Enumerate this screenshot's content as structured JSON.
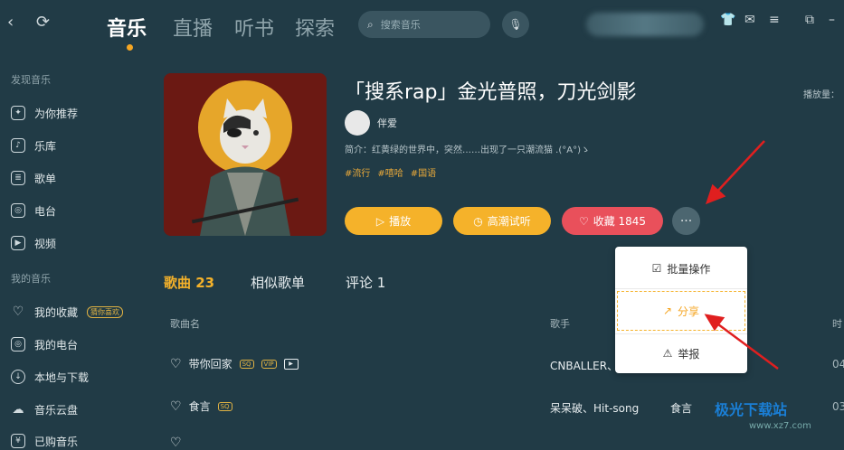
{
  "nav": {
    "tabs": [
      {
        "label": "音乐",
        "active": true
      },
      {
        "label": "直播"
      },
      {
        "label": "听书"
      },
      {
        "label": "探索"
      }
    ],
    "search_placeholder": "搜索音乐"
  },
  "sidebar": {
    "discover_heading": "发现音乐",
    "discover_items": [
      {
        "label": "为你推荐",
        "icon": "recommend-icon"
      },
      {
        "label": "乐库",
        "icon": "library-icon"
      },
      {
        "label": "歌单",
        "icon": "playlist-icon"
      },
      {
        "label": "电台",
        "icon": "radio-icon"
      },
      {
        "label": "视频",
        "icon": "video-icon"
      }
    ],
    "my_heading": "我的音乐",
    "my_items": [
      {
        "label": "我的收藏",
        "icon": "heart-icon",
        "badge": "猜你喜欢"
      },
      {
        "label": "我的电台",
        "icon": "radio-icon"
      },
      {
        "label": "本地与下载",
        "icon": "download-icon"
      },
      {
        "label": "音乐云盘",
        "icon": "cloud-icon"
      },
      {
        "label": "已购音乐",
        "icon": "purchased-icon"
      }
    ]
  },
  "playlist": {
    "title": "「搜系rap」金光普照，刀光剑影",
    "author": "伴爱",
    "description": "简介：红黄绿的世界中，突然……出现了一只潮流猫 .(°A°)ゝ",
    "tags": [
      "#流行",
      "#嘻哈",
      "#国语"
    ],
    "play_label": "播放",
    "hq_label": "高潮试听",
    "fav_label": "收藏 1845",
    "more_label": "···",
    "playcount_label": "播放量："
  },
  "tabs": [
    {
      "label": "歌曲 23",
      "active": true
    },
    {
      "label": "相似歌单"
    },
    {
      "label": "评论 1"
    }
  ],
  "table": {
    "headers": [
      "歌曲名",
      "歌手",
      "时"
    ],
    "rows": [
      {
        "title": "带你回家",
        "tags": [
          "SQ",
          "VIP"
        ],
        "mv": true,
        "artist": "CNBALLER、",
        "album": "",
        "time": "04"
      },
      {
        "title": "食言",
        "tags": [
          "SQ"
        ],
        "mv": false,
        "artist": "呆呆破、Hit-song",
        "album": "食言",
        "time": "03"
      },
      {
        "title": "",
        "tags": [],
        "mv": false,
        "artist": "",
        "album": "",
        "time": ""
      }
    ]
  },
  "context_menu": {
    "items": [
      {
        "label": "批量操作",
        "icon": "batch-icon"
      },
      {
        "label": "分享",
        "icon": "share-icon",
        "highlight": true
      },
      {
        "label": "举报",
        "icon": "warning-icon"
      }
    ]
  },
  "watermark": {
    "text": "极光下载站",
    "url": "www.xz7.com"
  },
  "colors": {
    "background": "#213b46",
    "accent": "#f5b22a",
    "favorite": "#e9505b",
    "arrow": "#e01f1f"
  }
}
